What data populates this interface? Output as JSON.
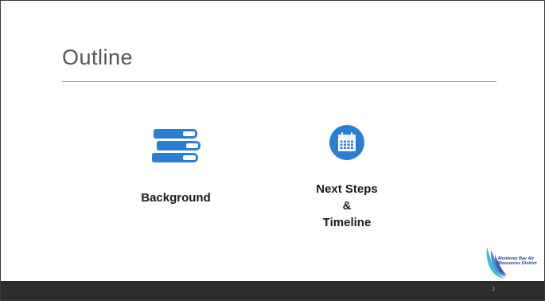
{
  "slide": {
    "title": "Outline",
    "page_number": "2",
    "items": [
      {
        "label": "Background",
        "icon": "books-icon"
      },
      {
        "label_lines": [
          "Next Steps",
          "&",
          "Timeline"
        ],
        "icon": "calendar-icon"
      }
    ],
    "logo": {
      "text_lines": [
        "Monterey Bay Air",
        "Resources District"
      ]
    }
  },
  "colors": {
    "accent_blue": "#2b7fd3",
    "title_gray": "#555555",
    "footer_bar": "#2d2d2d",
    "logo_teal": "#3cc0c8"
  }
}
